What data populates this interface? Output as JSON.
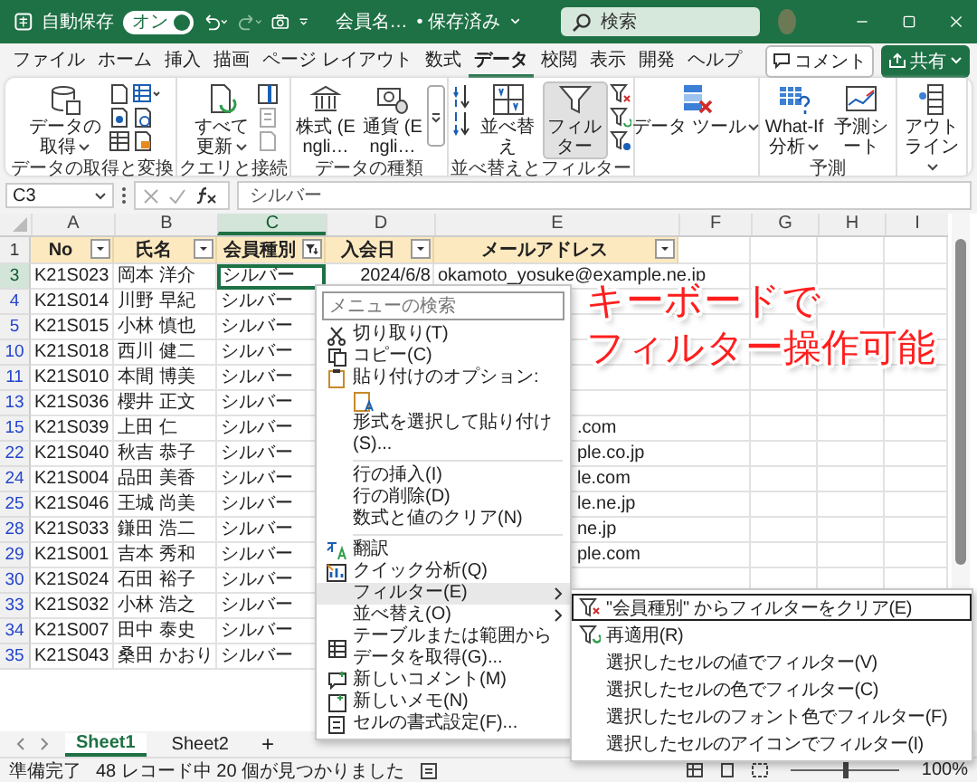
{
  "title_bar": {
    "autosave_label": "自動保存",
    "autosave_on": true,
    "toggle_label": "オン",
    "file_name": "会員名…",
    "save_status": "• 保存済み",
    "search_placeholder": "検索"
  },
  "ribbon_tabs": [
    {
      "label": "ファイル",
      "selected": false
    },
    {
      "label": "ホーム",
      "selected": false
    },
    {
      "label": "挿入",
      "selected": false
    },
    {
      "label": "描画",
      "selected": false
    },
    {
      "label": "ページ レイアウト",
      "selected": false
    },
    {
      "label": "数式",
      "selected": false
    },
    {
      "label": "データ",
      "selected": true
    },
    {
      "label": "校閲",
      "selected": false
    },
    {
      "label": "表示",
      "selected": false
    },
    {
      "label": "開発",
      "selected": false
    },
    {
      "label": "ヘルプ",
      "selected": false
    }
  ],
  "comment_button": "コメント",
  "share_button": "共有",
  "ribbon_groups": [
    {
      "label": "データの取得と変換",
      "kind": "get-data",
      "buttons": [
        {
          "label": "データの取得",
          "dropdown": true,
          "pressed": false
        }
      ]
    },
    {
      "label": "クエリと接続",
      "kind": "queries",
      "buttons": [
        {
          "label": "すべて更新",
          "dropdown": true,
          "pressed": false
        }
      ]
    },
    {
      "label": "データの種類",
      "kind": "data-types",
      "buttons": [
        {
          "label": "株式 (Engli…",
          "dropdown": false,
          "pressed": false
        },
        {
          "label": "通貨 (Engli…",
          "dropdown": false,
          "pressed": false
        }
      ]
    },
    {
      "label": "並べ替えとフィルター",
      "kind": "sort-filter",
      "buttons": [
        {
          "label": "並べ替え",
          "dropdown": false,
          "pressed": false
        },
        {
          "label": "フィルター",
          "dropdown": false,
          "pressed": true
        }
      ]
    },
    {
      "kind": "data-tools",
      "buttons": [
        {
          "label": "データ ツール",
          "dropdown": true,
          "pressed": false
        }
      ]
    },
    {
      "label": "予測",
      "kind": "forecast",
      "buttons": [
        {
          "label": "What-If 分析",
          "dropdown": true,
          "pressed": false
        },
        {
          "label": "予測シート",
          "dropdown": false,
          "pressed": false
        }
      ]
    },
    {
      "kind": "outline",
      "buttons": [
        {
          "label": "アウトライン",
          "dropdown": true,
          "pressed": false
        }
      ]
    }
  ],
  "formula_bar": {
    "name_box": "C3",
    "formula": "シルバー"
  },
  "columns": [
    {
      "label": "A",
      "selected": false
    },
    {
      "label": "B",
      "selected": false
    },
    {
      "label": "C",
      "selected": true
    },
    {
      "label": "D",
      "selected": false
    },
    {
      "label": "E",
      "selected": false
    },
    {
      "label": "F",
      "selected": false
    },
    {
      "label": "G",
      "selected": false
    },
    {
      "label": "H",
      "selected": false
    },
    {
      "label": "I",
      "selected": false
    }
  ],
  "header_row": {
    "row": "1",
    "cells": [
      {
        "text": "No",
        "filtered": false
      },
      {
        "text": "氏名",
        "filtered": false
      },
      {
        "text": "会員種別",
        "filtered": true
      },
      {
        "text": "入会日",
        "filtered": false
      },
      {
        "text": "メールアドレス",
        "filtered": false
      }
    ]
  },
  "rows": [
    {
      "row": "3",
      "selected": true,
      "id": "K21S023",
      "name": "岡本 洋介",
      "membership": "シルバー",
      "joined": "2024/6/8",
      "email": "okamoto_yosuke@example.ne.jp"
    },
    {
      "row": "4",
      "selected": false,
      "id": "K21S014",
      "name": "川野 早紀",
      "membership": "シルバー"
    },
    {
      "row": "5",
      "selected": false,
      "id": "K21S015",
      "name": "小林 慎也",
      "membership": "シルバー"
    },
    {
      "row": "10",
      "selected": false,
      "id": "K21S018",
      "name": "西川 健二",
      "membership": "シルバー"
    },
    {
      "row": "11",
      "selected": false,
      "id": "K21S010",
      "name": "本間 博美",
      "membership": "シルバー"
    },
    {
      "row": "13",
      "selected": false,
      "id": "K21S036",
      "name": "櫻井 正文",
      "membership": "シルバー"
    },
    {
      "row": "15",
      "selected": false,
      "id": "K21S039",
      "name": "上田 仁",
      "membership": "シルバー",
      "email": ".com"
    },
    {
      "row": "22",
      "selected": false,
      "id": "K21S040",
      "name": "秋吉 恭子",
      "membership": "シルバー",
      "email": "ple.co.jp"
    },
    {
      "row": "24",
      "selected": false,
      "id": "K21S004",
      "name": "品田 美香",
      "membership": "シルバー",
      "email": "le.com"
    },
    {
      "row": "25",
      "selected": false,
      "id": "K21S046",
      "name": "王城 尚美",
      "membership": "シルバー",
      "email": "le.ne.jp"
    },
    {
      "row": "28",
      "selected": false,
      "id": "K21S033",
      "name": "鎌田 浩二",
      "membership": "シルバー",
      "email": "ne.jp"
    },
    {
      "row": "29",
      "selected": false,
      "id": "K21S001",
      "name": "吉本 秀和",
      "membership": "シルバー",
      "email": "ple.com"
    },
    {
      "row": "30",
      "selected": false,
      "id": "K21S024",
      "name": "石田 裕子",
      "membership": "シルバー"
    },
    {
      "row": "33",
      "selected": false,
      "id": "K21S032",
      "name": "小林 浩之",
      "membership": "シルバー"
    },
    {
      "row": "34",
      "selected": false,
      "id": "K21S007",
      "name": "田中 泰史",
      "membership": "シルバー"
    },
    {
      "row": "35",
      "selected": false,
      "id": "K21S043",
      "name": "桑田 かおり",
      "membership": "シルバー"
    }
  ],
  "sheet_tabs": [
    {
      "label": "Sheet1",
      "selected": true
    },
    {
      "label": "Sheet2",
      "selected": false
    }
  ],
  "add_sheet": "+",
  "status_bar": {
    "ready": "準備完了",
    "count": "48 レコード中 20 個が見つかりました",
    "zoom": "100%",
    "zoom_slider": {
      "level": 0.5
    }
  },
  "context_menu": {
    "search_placeholder": "メニューの検索",
    "items": [
      {
        "kind": "cut",
        "label": "切り取り(T)"
      },
      {
        "kind": "copy",
        "label": "コピー(C)"
      },
      {
        "kind": "paste",
        "label": "貼り付けのオプション:"
      },
      {
        "kind": "paste-option"
      },
      {
        "kind": "plain",
        "label": "形式を選択して貼り付け(S)..."
      },
      {
        "kind": "separator"
      },
      {
        "kind": "plain",
        "label": "行の挿入(I)"
      },
      {
        "kind": "plain",
        "label": "行の削除(D)"
      },
      {
        "kind": "plain",
        "label": "数式と値のクリア(N)"
      },
      {
        "kind": "separator"
      },
      {
        "kind": "translate",
        "label": "翻訳"
      },
      {
        "kind": "analysis",
        "label": "クイック分析(Q)"
      },
      {
        "kind": "submenu",
        "label": "フィルター(E)",
        "selected": true
      },
      {
        "kind": "submenu",
        "label": "並べ替え(O)",
        "selected": false
      },
      {
        "kind": "table",
        "label": "テーブルまたは範囲からデータを取得(G)..."
      },
      {
        "kind": "comment",
        "label": "新しいコメント(M)"
      },
      {
        "kind": "memo",
        "label": "新しいメモ(N)"
      },
      {
        "kind": "format",
        "label": "セルの書式設定(F)..."
      }
    ]
  },
  "submenu": [
    {
      "kind": "clear-filter",
      "label": "\"会員種別\" からフィルターをクリア(E)",
      "selected": true
    },
    {
      "kind": "reapply",
      "label": "再適用(R)",
      "selected": false
    },
    {
      "kind": "plain",
      "label": "選択したセルの値でフィルター(V)",
      "selected": false
    },
    {
      "kind": "plain",
      "label": "選択したセルの色でフィルター(C)",
      "selected": false
    },
    {
      "kind": "plain",
      "label": "選択したセルのフォント色でフィルター(F)",
      "selected": false
    },
    {
      "kind": "plain",
      "label": "選択したセルのアイコンでフィルター(I)",
      "selected": false
    }
  ],
  "annotation": {
    "lines": [
      "キーボードで",
      "フィルター操作可能"
    ]
  }
}
